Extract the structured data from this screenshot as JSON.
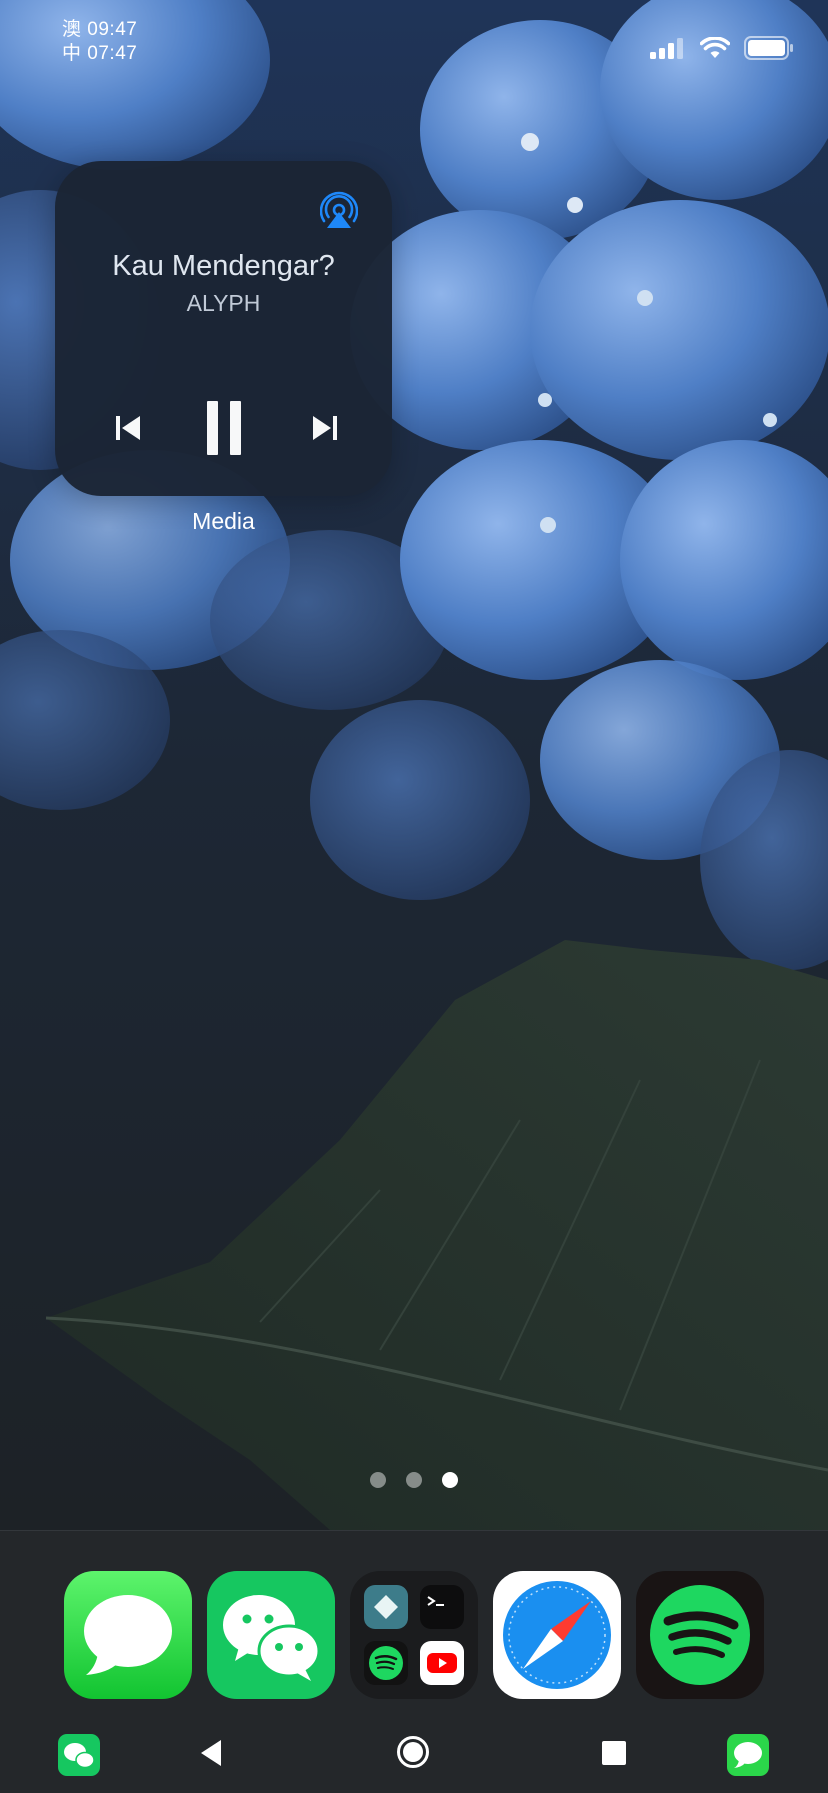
{
  "status_bar": {
    "time_line1": "澳 09:47",
    "time_line2": "中 07:47",
    "icons": [
      "signal-icon",
      "wifi-icon",
      "battery-icon"
    ]
  },
  "media_widget": {
    "track_title": "Kau Mendengar?",
    "artist": "ALYPH",
    "label": "Media",
    "icons": [
      "airplay-icon",
      "previous-track-icon",
      "pause-icon",
      "next-track-icon"
    ],
    "state": "playing"
  },
  "page_indicator": {
    "pages": 3,
    "current": 3
  },
  "dock": {
    "apps": [
      {
        "name": "Messages",
        "icon": "messages-app-icon"
      },
      {
        "name": "WeChat",
        "icon": "wechat-app-icon"
      },
      {
        "name": "Folder",
        "icon": "app-folder-icon",
        "contents": [
          "altstore-icon",
          "terminal-icon",
          "spotify-icon",
          "youtube-icon"
        ]
      },
      {
        "name": "Safari",
        "icon": "safari-app-icon"
      },
      {
        "name": "Spotify",
        "icon": "spotify-app-icon"
      }
    ]
  },
  "nav_bar": {
    "buttons": [
      "wechat-notification-icon",
      "back-icon",
      "home-icon",
      "recents-icon",
      "messages-notification-icon"
    ]
  },
  "colors": {
    "widget_bg": "#1b2535",
    "airplay_blue": "#1e8bff",
    "wechat_green": "#16c760",
    "spotify_green": "#1ed760",
    "dock_bg": "#24272a"
  }
}
